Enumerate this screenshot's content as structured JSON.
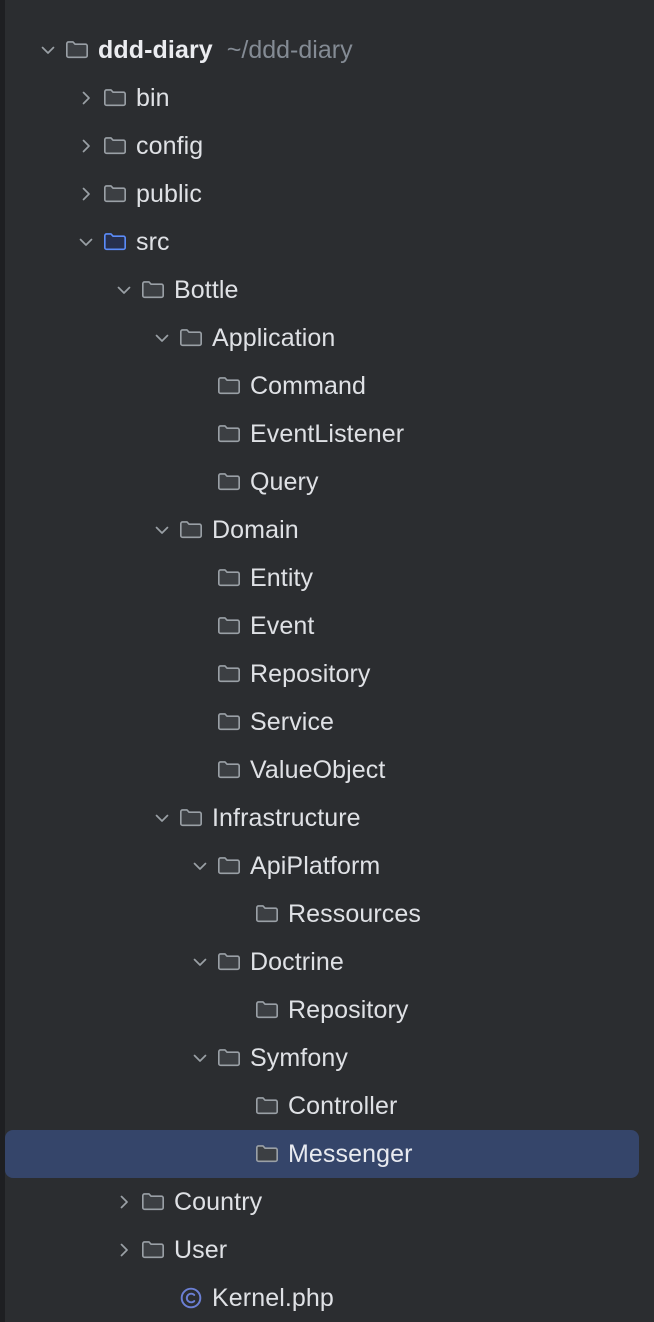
{
  "panel": {
    "name": "project-tree",
    "background_color": "#2b2d30",
    "gutter_color": "#1e1f22",
    "text_color": "#dfe1e5",
    "path_text_color": "#848b94",
    "selection_color": "#35456a",
    "folder_icon_color": "#9aa0a6",
    "source_folder_icon_color": "#5b8cfa",
    "class_icon_color": "#6b7fd4",
    "chevron_color": "#9aa0a6"
  },
  "tree": {
    "nodes": [
      {
        "label": "ddd-diary",
        "path_suffix": "~/ddd-diary",
        "depth": 0,
        "icon": "folder-icon",
        "state": "expanded",
        "bold": true,
        "selected": false
      },
      {
        "label": "bin",
        "path_suffix": "",
        "depth": 1,
        "icon": "folder-icon",
        "state": "collapsed",
        "bold": false,
        "selected": false
      },
      {
        "label": "config",
        "path_suffix": "",
        "depth": 1,
        "icon": "folder-icon",
        "state": "collapsed",
        "bold": false,
        "selected": false
      },
      {
        "label": "public",
        "path_suffix": "",
        "depth": 1,
        "icon": "folder-icon",
        "state": "collapsed",
        "bold": false,
        "selected": false
      },
      {
        "label": "src",
        "path_suffix": "",
        "depth": 1,
        "icon": "source-folder-icon",
        "state": "expanded",
        "bold": false,
        "selected": false
      },
      {
        "label": "Bottle",
        "path_suffix": "",
        "depth": 2,
        "icon": "folder-icon",
        "state": "expanded",
        "bold": false,
        "selected": false
      },
      {
        "label": "Application",
        "path_suffix": "",
        "depth": 3,
        "icon": "folder-icon",
        "state": "expanded",
        "bold": false,
        "selected": false
      },
      {
        "label": "Command",
        "path_suffix": "",
        "depth": 4,
        "icon": "folder-icon",
        "state": "leaf",
        "bold": false,
        "selected": false
      },
      {
        "label": "EventListener",
        "path_suffix": "",
        "depth": 4,
        "icon": "folder-icon",
        "state": "leaf",
        "bold": false,
        "selected": false
      },
      {
        "label": "Query",
        "path_suffix": "",
        "depth": 4,
        "icon": "folder-icon",
        "state": "leaf",
        "bold": false,
        "selected": false
      },
      {
        "label": "Domain",
        "path_suffix": "",
        "depth": 3,
        "icon": "folder-icon",
        "state": "expanded",
        "bold": false,
        "selected": false
      },
      {
        "label": "Entity",
        "path_suffix": "",
        "depth": 4,
        "icon": "folder-icon",
        "state": "leaf",
        "bold": false,
        "selected": false
      },
      {
        "label": "Event",
        "path_suffix": "",
        "depth": 4,
        "icon": "folder-icon",
        "state": "leaf",
        "bold": false,
        "selected": false
      },
      {
        "label": "Repository",
        "path_suffix": "",
        "depth": 4,
        "icon": "folder-icon",
        "state": "leaf",
        "bold": false,
        "selected": false
      },
      {
        "label": "Service",
        "path_suffix": "",
        "depth": 4,
        "icon": "folder-icon",
        "state": "leaf",
        "bold": false,
        "selected": false
      },
      {
        "label": "ValueObject",
        "path_suffix": "",
        "depth": 4,
        "icon": "folder-icon",
        "state": "leaf",
        "bold": false,
        "selected": false
      },
      {
        "label": "Infrastructure",
        "path_suffix": "",
        "depth": 3,
        "icon": "folder-icon",
        "state": "expanded",
        "bold": false,
        "selected": false
      },
      {
        "label": "ApiPlatform",
        "path_suffix": "",
        "depth": 4,
        "icon": "folder-icon",
        "state": "expanded",
        "bold": false,
        "selected": false
      },
      {
        "label": "Ressources",
        "path_suffix": "",
        "depth": 5,
        "icon": "folder-icon",
        "state": "leaf",
        "bold": false,
        "selected": false
      },
      {
        "label": "Doctrine",
        "path_suffix": "",
        "depth": 4,
        "icon": "folder-icon",
        "state": "expanded",
        "bold": false,
        "selected": false
      },
      {
        "label": "Repository",
        "path_suffix": "",
        "depth": 5,
        "icon": "folder-icon",
        "state": "leaf",
        "bold": false,
        "selected": false
      },
      {
        "label": "Symfony",
        "path_suffix": "",
        "depth": 4,
        "icon": "folder-icon",
        "state": "expanded",
        "bold": false,
        "selected": false
      },
      {
        "label": "Controller",
        "path_suffix": "",
        "depth": 5,
        "icon": "folder-icon",
        "state": "leaf",
        "bold": false,
        "selected": false
      },
      {
        "label": "Messenger",
        "path_suffix": "",
        "depth": 5,
        "icon": "folder-icon",
        "state": "leaf",
        "bold": false,
        "selected": true
      },
      {
        "label": "Country",
        "path_suffix": "",
        "depth": 2,
        "icon": "folder-icon",
        "state": "collapsed",
        "bold": false,
        "selected": false
      },
      {
        "label": "User",
        "path_suffix": "",
        "depth": 2,
        "icon": "folder-icon",
        "state": "collapsed",
        "bold": false,
        "selected": false
      },
      {
        "label": "Kernel.php",
        "path_suffix": "",
        "depth": 3,
        "icon": "php-class-icon",
        "state": "leaf",
        "bold": false,
        "selected": false
      }
    ]
  }
}
